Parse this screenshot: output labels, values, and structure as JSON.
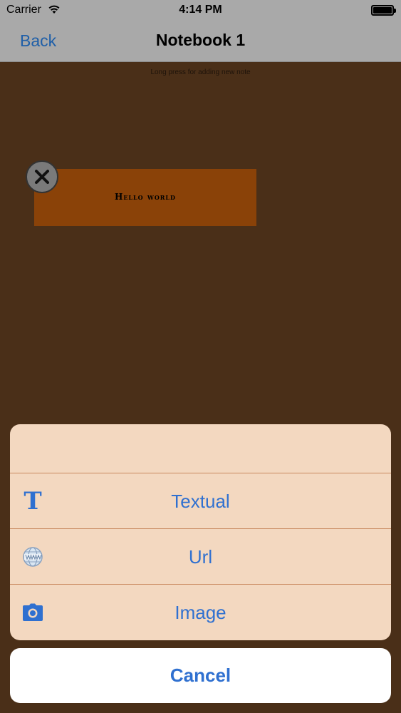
{
  "status_bar": {
    "carrier": "Carrier",
    "time": "4:14 PM"
  },
  "nav": {
    "back_label": "Back",
    "title": "Notebook 1"
  },
  "hint": "Long press for adding new note",
  "note": {
    "text": "Hello world"
  },
  "action_sheet": {
    "items": [
      {
        "label": "Textual",
        "icon": "text-t-icon"
      },
      {
        "label": "Url",
        "icon": "globe-www-icon"
      },
      {
        "label": "Image",
        "icon": "camera-icon"
      }
    ],
    "cancel_label": "Cancel"
  },
  "colors": {
    "accent": "#2f70d0",
    "background": "#4a2f18",
    "sheet": "#f3d8c0",
    "note": "#8a4208"
  }
}
